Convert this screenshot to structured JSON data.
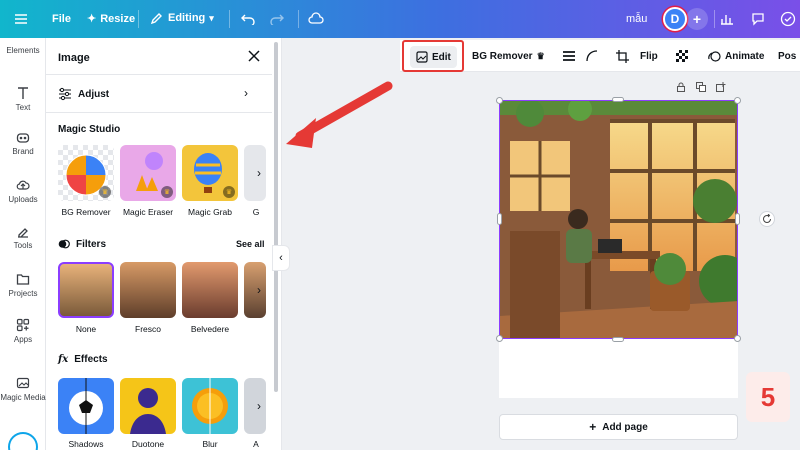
{
  "topbar": {
    "file": "File",
    "resize": "Resize",
    "editing": "Editing",
    "design_name": "mẫu",
    "avatar_initial": "D"
  },
  "rail": [
    {
      "label": "Elements",
      "icon": "elements-icon"
    },
    {
      "label": "Text",
      "icon": "text-icon"
    },
    {
      "label": "Brand",
      "icon": "brand-icon"
    },
    {
      "label": "Uploads",
      "icon": "uploads-icon"
    },
    {
      "label": "Tools",
      "icon": "tools-icon"
    },
    {
      "label": "Projects",
      "icon": "projects-icon"
    },
    {
      "label": "Apps",
      "icon": "apps-icon"
    },
    {
      "label": "Magic Media",
      "icon": "magic-media-icon"
    }
  ],
  "panel": {
    "title": "Image",
    "adjust": "Adjust",
    "magic_studio": {
      "heading": "Magic Studio",
      "items": [
        "BG Remover",
        "Magic Eraser",
        "Magic Grab",
        "G"
      ]
    },
    "filters": {
      "heading": "Filters",
      "see_all": "See all",
      "items": [
        "None",
        "Fresco",
        "Belvedere"
      ]
    },
    "effects": {
      "heading": "Effects",
      "items": [
        "Shadows",
        "Duotone",
        "Blur",
        "A"
      ]
    }
  },
  "context_toolbar": {
    "edit": "Edit",
    "bg_remover": "BG Remover",
    "flip": "Flip",
    "animate": "Animate",
    "position": "Pos"
  },
  "canvas": {
    "add_page": "Add page",
    "step_number": "5"
  },
  "colors": {
    "accent_purple": "#8b3dff",
    "highlight_red": "#e53935"
  }
}
